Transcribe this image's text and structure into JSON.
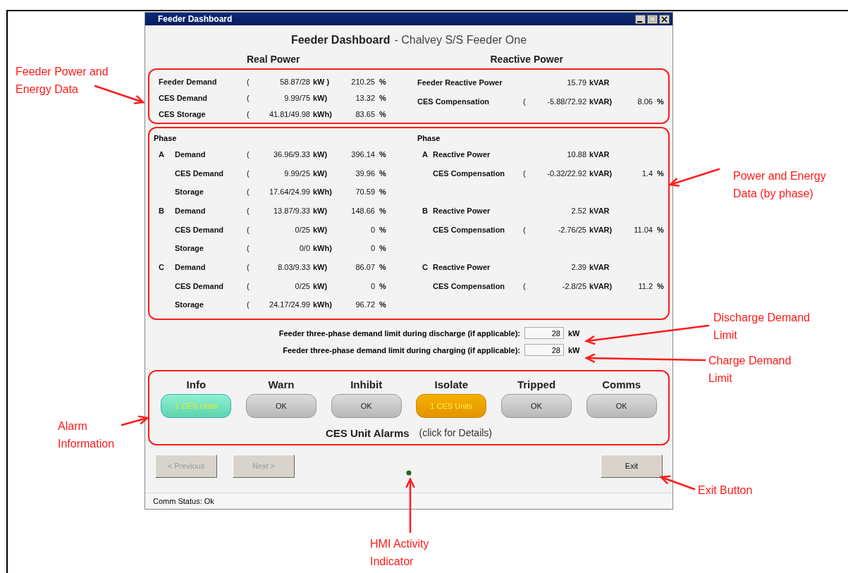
{
  "window": {
    "title": "Feeder Dashboard"
  },
  "heading": {
    "title": "Feeder Dashboard",
    "subtitle": "- Chalvey S/S Feeder One"
  },
  "columns": [
    "Real Power",
    "Reactive Power"
  ],
  "feeder": {
    "real": [
      {
        "label": "Feeder Demand",
        "open": "(",
        "value": "58.87/28",
        "unit": "kW )",
        "percent": "210.25",
        "percent_unit": "%"
      },
      {
        "label": "CES Demand",
        "open": "(",
        "value": "9.99/75",
        "unit": "kW)",
        "percent": "13.32",
        "percent_unit": "%"
      },
      {
        "label": "CES Storage",
        "open": "(",
        "value": "41.81/49.98",
        "unit": "kWh)",
        "percent": "83.65",
        "percent_unit": "%"
      }
    ],
    "reactive": [
      {
        "label": "Feeder Reactive Power",
        "value": "15.79",
        "unit": "kVAR"
      },
      {
        "label": "CES Compensation",
        "open": "(",
        "value": "-5.88/72.92",
        "unit": "kVAR)",
        "percent": "8.06",
        "percent_unit": "%"
      }
    ]
  },
  "phases": {
    "real_heading": "Phase",
    "reactive_heading": "Phase",
    "items": [
      {
        "letter_real": "A",
        "letter_reactive": "A",
        "real": [
          {
            "label": "Demand",
            "open": "(",
            "value": "36.96/9.33",
            "unit": "kW)",
            "percent": "396.14",
            "percent_unit": "%"
          },
          {
            "label": "CES Demand",
            "open": "(",
            "value": "9.99/25",
            "unit": "kW)",
            "percent": "39.96",
            "percent_unit": "%"
          },
          {
            "label": "Storage",
            "open": "(",
            "value": "17.64/24.99",
            "unit": "kWh)",
            "percent": "70.59",
            "percent_unit": "%"
          }
        ],
        "reactive": [
          {
            "label": "Reactive Power",
            "value": "10.88",
            "unit": "kVAR"
          },
          {
            "label": "CES Compensation",
            "open": "(",
            "value": "-0.32/22.92",
            "unit": "kVAR)",
            "percent": "1.4",
            "percent_unit": "%"
          }
        ]
      },
      {
        "letter_real": "B",
        "letter_reactive": "B",
        "real": [
          {
            "label": "Demand",
            "open": "(",
            "value": "13.87/9.33",
            "unit": "kW)",
            "percent": "148.66",
            "percent_unit": "%"
          },
          {
            "label": "CES Demand",
            "open": "(",
            "value": "0/25",
            "unit": "kW)",
            "percent": "0",
            "percent_unit": "%"
          },
          {
            "label": "Storage",
            "open": "(",
            "value": "0/0",
            "unit": "kWh)",
            "percent": "0",
            "percent_unit": "%"
          }
        ],
        "reactive": [
          {
            "label": "Reactive Power",
            "value": "2.52",
            "unit": "kVAR"
          },
          {
            "label": "CES Compensation",
            "open": "(",
            "value": "-2.76/25",
            "unit": "kVAR)",
            "percent": "11.04",
            "percent_unit": "%"
          }
        ]
      },
      {
        "letter_real": "C",
        "letter_reactive": "C",
        "real": [
          {
            "label": "Demand",
            "open": "(",
            "value": "8.03/9.33",
            "unit": "kW)",
            "percent": "86.07",
            "percent_unit": "%"
          },
          {
            "label": "CES Demand",
            "open": "(",
            "value": "0/25",
            "unit": "kW)",
            "percent": "0",
            "percent_unit": "%"
          },
          {
            "label": "Storage",
            "open": "(",
            "value": "24.17/24.99",
            "unit": "kWh)",
            "percent": "96.72",
            "percent_unit": "%"
          }
        ],
        "reactive": [
          {
            "label": "Reactive Power",
            "value": "2.39",
            "unit": "kVAR"
          },
          {
            "label": "CES Compensation",
            "open": "(",
            "value": "-2.8/25",
            "unit": "kVAR)",
            "percent": "11.2",
            "percent_unit": "%"
          }
        ]
      }
    ]
  },
  "limits": [
    {
      "label": "Feeder three-phase demand limit during discharge (if applicable):",
      "value": "28",
      "unit": "kW"
    },
    {
      "label": "Feeder three-phase demand limit during charging (if applicable):",
      "value": "28",
      "unit": "kW"
    }
  ],
  "alarms": {
    "items": [
      {
        "label": "Info",
        "status": "1 CES Units",
        "kind": "info"
      },
      {
        "label": "Warn",
        "status": "OK",
        "kind": "ok"
      },
      {
        "label": "Inhibit",
        "status": "OK",
        "kind": "ok"
      },
      {
        "label": "Isolate",
        "status": "1 CES Units",
        "kind": "isolate"
      },
      {
        "label": "Tripped",
        "status": "OK",
        "kind": "ok"
      },
      {
        "label": "Comms",
        "status": "OK",
        "kind": "ok"
      }
    ],
    "caption": "CES Unit Alarms",
    "hint": "(click for Details)"
  },
  "nav": {
    "left": [
      {
        "label": "< Previous",
        "disabled": true
      },
      {
        "label": "Next >",
        "disabled": true
      }
    ],
    "right": [
      {
        "label": "Exit",
        "disabled": false
      }
    ]
  },
  "status_bar": "Comm Status: Ok",
  "annotations": [
    {
      "text": "Feeder Power and Energy Data"
    },
    {
      "text": "Power and Energy Data (by phase)"
    },
    {
      "text": "Discharge Demand Limit"
    },
    {
      "text": "Charge Demand Limit"
    },
    {
      "text": "Alarm Information"
    },
    {
      "text": "Exit Button"
    },
    {
      "text": "HMI Activity Indicator"
    }
  ]
}
